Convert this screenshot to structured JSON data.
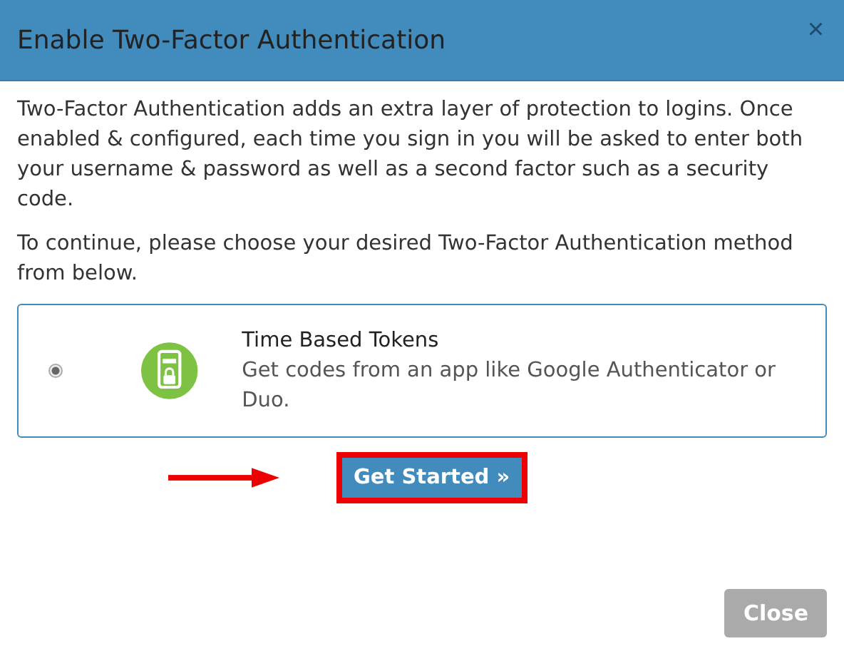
{
  "dialog": {
    "title": "Enable Two-Factor Authentication",
    "close_icon": "×"
  },
  "intro": "Two-Factor Authentication adds an extra layer of protection to logins. Once enabled & configured, each time you sign in you will be asked to enter both your username & password as well as a second factor such as a security code.",
  "prompt": "To continue, please choose your desired Two-Factor Authentication method from below.",
  "methods": [
    {
      "title": "Time Based Tokens",
      "description": "Get codes from an app like Google Authenticator or Duo.",
      "selected": true
    }
  ],
  "primary_button": "Get Started »",
  "footer_button": "Close"
}
